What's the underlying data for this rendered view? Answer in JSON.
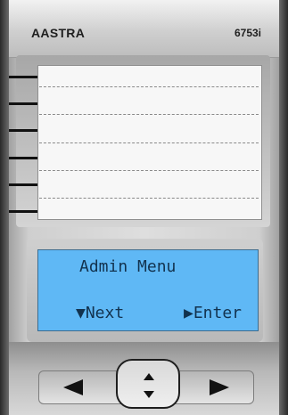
{
  "header": {
    "brand": "AASTRA",
    "model": "6753i"
  },
  "display": {
    "title": "Admin Menu",
    "softkey_next": "▼Next",
    "softkey_enter": "▶Enter"
  },
  "icons": {
    "left": "left-arrow-icon",
    "up": "up-arrow-icon",
    "down": "down-arrow-icon",
    "right": "right-arrow-icon"
  },
  "colors": {
    "lcd_background": "#5fb8f5",
    "lcd_text": "#12324e"
  }
}
